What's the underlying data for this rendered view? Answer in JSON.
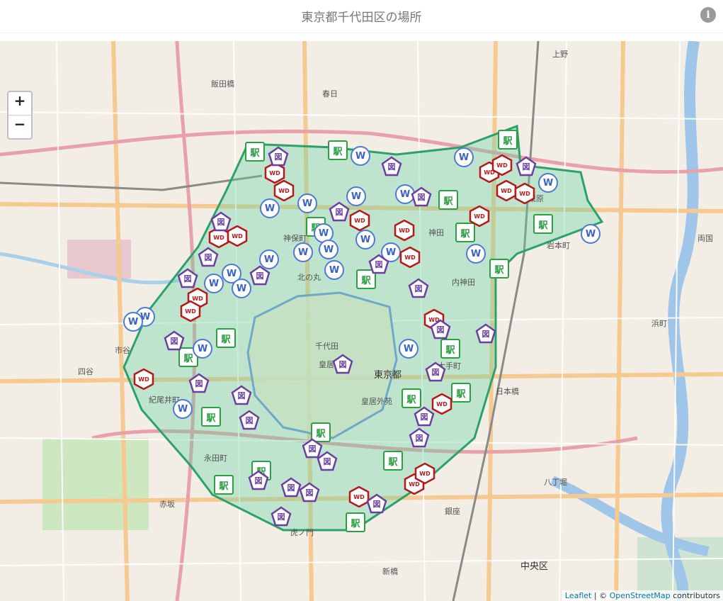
{
  "header": {
    "title": "東京都千代田区の場所",
    "info_icon": "info-icon"
  },
  "zoom": {
    "in_label": "+",
    "out_label": "−"
  },
  "attribution": {
    "leaflet": "Leaflet",
    "sep": " | © ",
    "osm": "OpenStreetMap",
    "suffix": " contributors"
  },
  "map_labels": [
    {
      "id": "chuo-ku",
      "text": "中央区",
      "big": true
    },
    {
      "id": "tokyo-to",
      "text": "東京都",
      "big": true
    },
    {
      "id": "chiyoda",
      "text": "千代田",
      "big": false
    },
    {
      "id": "kokyo",
      "text": "皇居",
      "big": false
    },
    {
      "id": "kokyo-gaien",
      "text": "皇居外苑",
      "big": false
    },
    {
      "id": "kanda",
      "text": "神田",
      "big": false
    },
    {
      "id": "uchikanda",
      "text": "内神田",
      "big": false
    },
    {
      "id": "ueno",
      "text": "上野",
      "big": false
    },
    {
      "id": "iwamotocho",
      "text": "岩本町",
      "big": false
    },
    {
      "id": "nihonbashi",
      "text": "日本橋",
      "big": false
    },
    {
      "id": "hatchobori",
      "text": "八丁堀",
      "big": false
    },
    {
      "id": "ginza",
      "text": "銀座",
      "big": false
    },
    {
      "id": "shinbashi",
      "text": "新橋",
      "big": false
    },
    {
      "id": "nagatacho",
      "text": "永田町",
      "big": false
    },
    {
      "id": "akasaka",
      "text": "赤坂",
      "big": false
    },
    {
      "id": "ichigaya",
      "text": "市谷",
      "big": false
    },
    {
      "id": "iidabashi",
      "text": "飯田橋",
      "big": false
    },
    {
      "id": "kasuga",
      "text": "春日",
      "big": false
    },
    {
      "id": "kitanomaru",
      "text": "北の丸",
      "big": false
    },
    {
      "id": "kioicho",
      "text": "紀尾井町",
      "big": false
    },
    {
      "id": "toranomon",
      "text": "虎ノ門",
      "big": false
    },
    {
      "id": "shinjuku-line",
      "text": "四谷",
      "big": false
    },
    {
      "id": "shibuya",
      "text": "神保町",
      "big": false
    },
    {
      "id": "otemachi",
      "text": "大手町",
      "big": false
    },
    {
      "id": "ryogoku",
      "text": "両国",
      "big": false
    },
    {
      "id": "hamacho",
      "text": "浜町",
      "big": false
    },
    {
      "id": "akihabara",
      "text": "秋葉原",
      "big": false
    }
  ],
  "markers": [
    {
      "type": "eki",
      "label": "駅"
    },
    {
      "type": "eki",
      "label": "駅"
    },
    {
      "type": "eki",
      "label": "駅"
    },
    {
      "type": "eki",
      "label": "駅"
    },
    {
      "type": "eki",
      "label": "駅"
    },
    {
      "type": "eki",
      "label": "駅"
    },
    {
      "type": "eki",
      "label": "駅"
    },
    {
      "type": "eki",
      "label": "駅"
    },
    {
      "type": "eki",
      "label": "駅"
    },
    {
      "type": "eki",
      "label": "駅"
    },
    {
      "type": "eki",
      "label": "駅"
    },
    {
      "type": "eki",
      "label": "駅"
    },
    {
      "type": "eki",
      "label": "駅"
    },
    {
      "type": "eki",
      "label": "駅"
    },
    {
      "type": "eki",
      "label": "駅"
    },
    {
      "type": "eki",
      "label": "駅"
    },
    {
      "type": "eki",
      "label": "駅"
    },
    {
      "type": "eki",
      "label": "駅"
    },
    {
      "type": "eki",
      "label": "駅"
    },
    {
      "type": "eki",
      "label": "駅"
    },
    {
      "type": "w",
      "label": "W"
    },
    {
      "type": "w",
      "label": "W"
    },
    {
      "type": "w",
      "label": "W"
    },
    {
      "type": "w",
      "label": "W"
    },
    {
      "type": "w",
      "label": "W"
    },
    {
      "type": "w",
      "label": "W"
    },
    {
      "type": "w",
      "label": "W"
    },
    {
      "type": "w",
      "label": "W"
    },
    {
      "type": "w",
      "label": "W"
    },
    {
      "type": "w",
      "label": "W"
    },
    {
      "type": "w",
      "label": "W"
    },
    {
      "type": "w",
      "label": "W"
    },
    {
      "type": "w",
      "label": "W"
    },
    {
      "type": "w",
      "label": "W"
    },
    {
      "type": "w",
      "label": "W"
    },
    {
      "type": "w",
      "label": "W"
    },
    {
      "type": "w",
      "label": "W"
    },
    {
      "type": "w",
      "label": "W"
    },
    {
      "type": "w",
      "label": "W"
    },
    {
      "type": "w",
      "label": "W"
    },
    {
      "type": "w",
      "label": "W"
    },
    {
      "type": "w",
      "label": "W"
    },
    {
      "type": "w",
      "label": "W"
    },
    {
      "type": "w",
      "label": "W"
    },
    {
      "type": "wd",
      "label": "WD"
    },
    {
      "type": "wd",
      "label": "WD"
    },
    {
      "type": "wd",
      "label": "WD"
    },
    {
      "type": "wd",
      "label": "WD"
    },
    {
      "type": "wd",
      "label": "WD"
    },
    {
      "type": "wd",
      "label": "WD"
    },
    {
      "type": "wd",
      "label": "WD"
    },
    {
      "type": "wd",
      "label": "WD"
    },
    {
      "type": "wd",
      "label": "WD"
    },
    {
      "type": "wd",
      "label": "WD"
    },
    {
      "type": "wd",
      "label": "WD"
    },
    {
      "type": "wd",
      "label": "WD"
    },
    {
      "type": "wd",
      "label": "WD"
    },
    {
      "type": "wd",
      "label": "WD"
    },
    {
      "type": "wd",
      "label": "WD"
    },
    {
      "type": "wd",
      "label": "WD"
    },
    {
      "type": "wd",
      "label": "WD"
    },
    {
      "type": "wd",
      "label": "WD"
    },
    {
      "type": "wd",
      "label": "WD"
    },
    {
      "type": "wd",
      "label": "WD"
    },
    {
      "type": "zu",
      "label": "図"
    },
    {
      "type": "zu",
      "label": "図"
    },
    {
      "type": "zu",
      "label": "図"
    },
    {
      "type": "zu",
      "label": "図"
    },
    {
      "type": "zu",
      "label": "図"
    },
    {
      "type": "zu",
      "label": "図"
    },
    {
      "type": "zu",
      "label": "図"
    },
    {
      "type": "zu",
      "label": "図"
    },
    {
      "type": "zu",
      "label": "図"
    },
    {
      "type": "zu",
      "label": "図"
    },
    {
      "type": "zu",
      "label": "図"
    },
    {
      "type": "zu",
      "label": "図"
    },
    {
      "type": "zu",
      "label": "図"
    },
    {
      "type": "zu",
      "label": "図"
    },
    {
      "type": "zu",
      "label": "図"
    },
    {
      "type": "zu",
      "label": "図"
    },
    {
      "type": "zu",
      "label": "図"
    },
    {
      "type": "zu",
      "label": "図"
    },
    {
      "type": "zu",
      "label": "図"
    },
    {
      "type": "zu",
      "label": "図"
    },
    {
      "type": "zu",
      "label": "図"
    },
    {
      "type": "zu",
      "label": "図"
    },
    {
      "type": "zu",
      "label": "図"
    },
    {
      "type": "zu",
      "label": "図"
    },
    {
      "type": "zu",
      "label": "図"
    },
    {
      "type": "zu",
      "label": "図"
    },
    {
      "type": "zu",
      "label": "図"
    },
    {
      "type": "zu",
      "label": "図"
    }
  ]
}
